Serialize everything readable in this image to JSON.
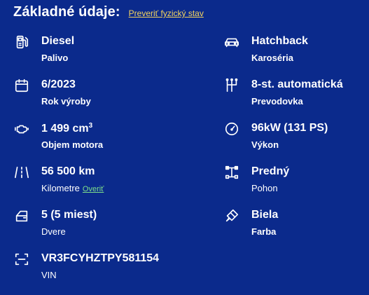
{
  "header": {
    "title": "Základné údaje:",
    "check_link": "Preveriť fyzický stav"
  },
  "details": [
    {
      "id": "fuel",
      "icon": "fuel-pump-icon",
      "value": "Diesel",
      "label": "Palivo"
    },
    {
      "id": "body",
      "icon": "car-icon",
      "value": "Hatchback",
      "label": "Karoséria"
    },
    {
      "id": "year",
      "icon": "calendar-icon",
      "value": "6/2023",
      "label": "Rok výroby"
    },
    {
      "id": "gearbox",
      "icon": "gearbox-icon",
      "value": "8-st. automatická",
      "label": "Prevodovka"
    },
    {
      "id": "engine",
      "icon": "engine-icon",
      "value": "1 499 cm",
      "value_sup": "3",
      "label": "Objem motora"
    },
    {
      "id": "power",
      "icon": "speedometer-icon",
      "value": "96kW (131 PS)",
      "label": "Výkon"
    },
    {
      "id": "mileage",
      "icon": "road-icon",
      "value": "56 500 km",
      "label": "Kilometre",
      "label_link": "Overiť"
    },
    {
      "id": "drive",
      "icon": "drivetrain-icon",
      "value": "Predný",
      "label": "Pohon"
    },
    {
      "id": "doors",
      "icon": "car-door-icon",
      "value": "5 (5 miest)",
      "label": "Dvere"
    },
    {
      "id": "color",
      "icon": "paint-brush-icon",
      "value": "Biela",
      "label": "Farba"
    },
    {
      "id": "vin",
      "icon": "scan-icon",
      "value": "VR3FCYHZTPY581154",
      "label": "VIN"
    }
  ],
  "colors": {
    "background": "#0b2a8c",
    "text": "#ffffff",
    "link_yellow": "#f4d35e",
    "link_green": "#7ee08a"
  }
}
